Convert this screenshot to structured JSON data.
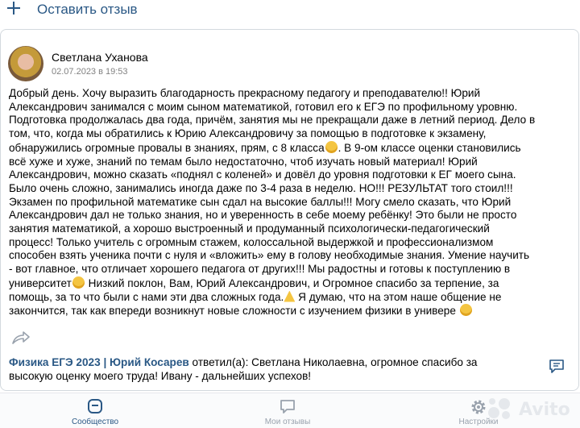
{
  "top": {
    "leave_review_label": "Оставить отзыв",
    "plus_icon": "plus-icon"
  },
  "review": {
    "author": "Светлана Уханова",
    "date": "02.07.2023 в 19:53",
    "lines": [
      "Добрый день. Хочу выразить благодарность прекрасному педагогу и преподавателю!! Юрий",
      "Александрович занимался с моим сыном математикой, готовил его к ЕГЭ по профильному уровню.",
      "Подготовка продолжалась два года, причём, занятия мы не прекращали даже в летний период. Дело в",
      "том, что, когда мы обратились к Юрию Александровичу за помощью в подготовке к экзамену,",
      "обнаружились огромные провалы в знаниях, прям, с 8 класса",
      ". В 9-ом классе оценки становились",
      "всё хуже и хуже, знаний по темам было недостаточно, чтоб изучать новый материал! Юрий",
      "Александрович, можно сказать «поднял с коленей» и довёл до уровня подготовки к ЕГ моего сына.",
      "Было очень сложно, занимались иногда даже по 3-4 раза в неделю. НО!!! РЕЗУЛЬТАТ того стоил!!!",
      "Экзамен по профильной математике сын сдал на высокие баллы!!! Могу смело сказать, что Юрий",
      "Александрович дал не только знания, но и уверенность в себе моему ребёнку! Это были не просто",
      "занятия математикой, а хорошо выстроенный и продуманный психологически-педагогический",
      "процесс! Только учитель с огромным стажем, колоссальной выдержкой и профессионализмом",
      "способен взять ученика почти с нуля и «вложить» ему в голову необходимые знания. Умение научить",
      "- вот главное, что отличает хорошего педагога от других!!! Мы радостны и готовы к поступлению в",
      "университет",
      " Низкий поклон, Вам, Юрий Александрович, и Огромное спасибо за терпение, за",
      "помощь, за то что были с нами эти два сложных года.",
      " Я думаю, что на этом наше общение не",
      "закончится, так как впереди возникнут новые сложности с изучением физики в универе"
    ]
  },
  "reply": {
    "author": "Физика ЕГЭ 2023 | Юрий Косарев",
    "verb": " ответил(а): ",
    "line1": "Светлана Николаевна, огромное спасибо за",
    "line2": "высокую оценку моего труда! Ивану - дальнейших успехов!"
  },
  "nav": {
    "community": "Сообщество",
    "my_reviews": "Мои отзывы",
    "settings": "Настройки"
  },
  "watermark": {
    "text": "Avito"
  },
  "colors": {
    "link": "#2a5885",
    "muted": "#828282",
    "nav_inactive": "#99a2ad"
  }
}
